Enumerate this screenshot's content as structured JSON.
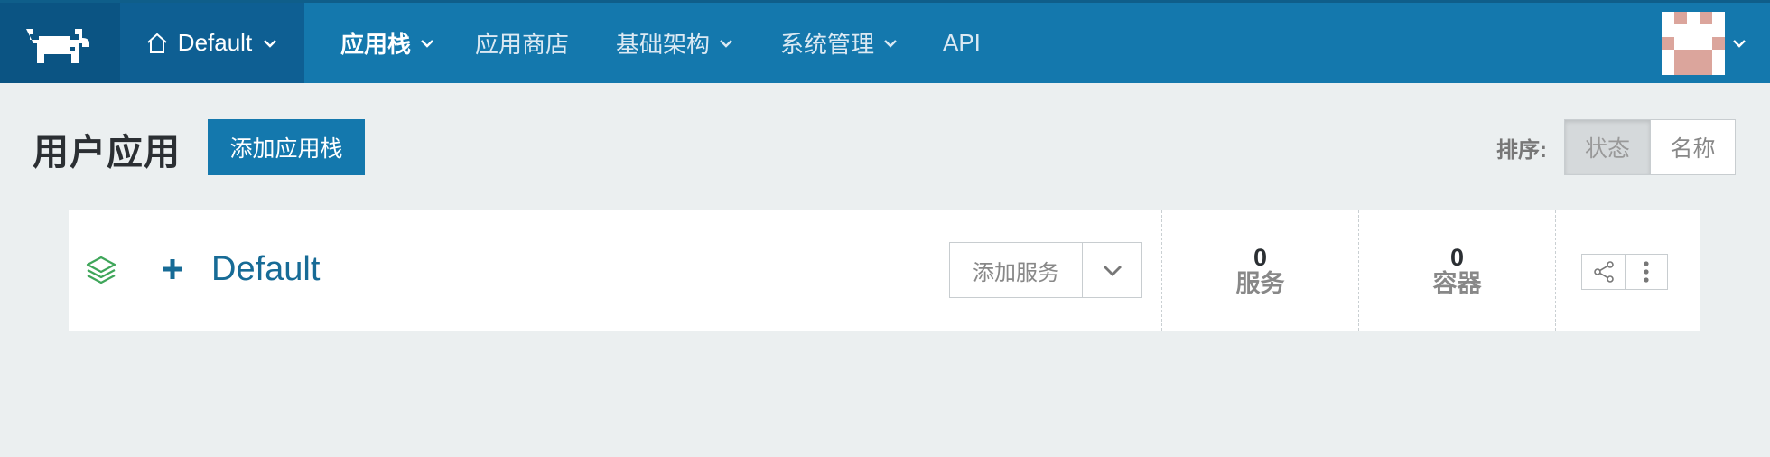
{
  "nav": {
    "logo_icon": "rancher-cow-icon",
    "environment": {
      "icon": "home-icon",
      "label": "Default"
    },
    "items": [
      {
        "label": "应用栈",
        "active": true,
        "has_dropdown": true
      },
      {
        "label": "应用商店",
        "active": false,
        "has_dropdown": false
      },
      {
        "label": "基础架构",
        "active": false,
        "has_dropdown": true
      },
      {
        "label": "系统管理",
        "active": false,
        "has_dropdown": true
      },
      {
        "label": "API",
        "active": false,
        "has_dropdown": false
      }
    ],
    "colors": {
      "bar": "#1478ad",
      "logo_bg": "#0b5483",
      "env_bg": "#0e5f93"
    }
  },
  "header": {
    "title": "用户应用",
    "add_stack_label": "添加应用栈",
    "sort": {
      "label": "排序:",
      "options": [
        "状态",
        "名称"
      ],
      "selected": "状态"
    }
  },
  "stack": {
    "name": "Default",
    "add_service_label": "添加服务",
    "services": {
      "count": "0",
      "label": "服务"
    },
    "containers": {
      "count": "0",
      "label": "容器"
    },
    "icons": [
      "layers-icon",
      "plus-icon",
      "share-icon",
      "more-vertical-icon"
    ]
  }
}
